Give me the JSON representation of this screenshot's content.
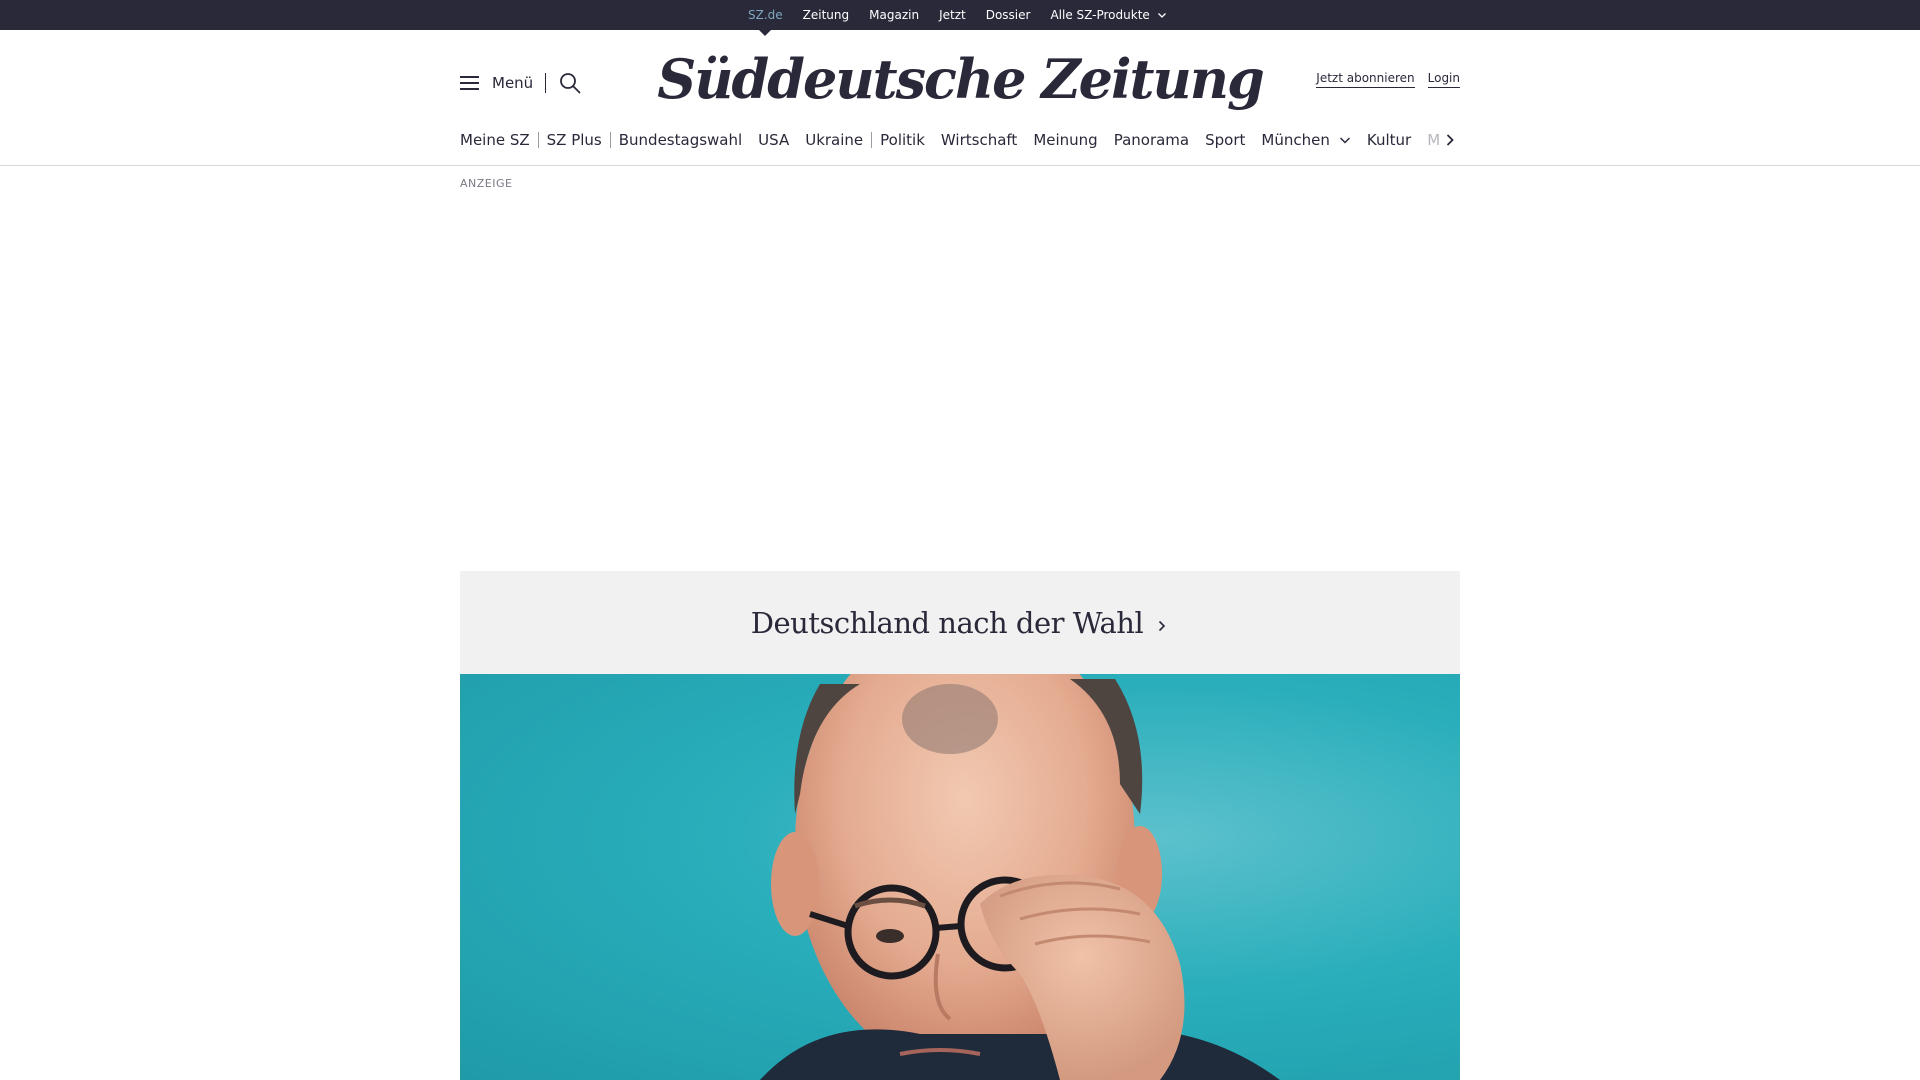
{
  "topbar": {
    "links": [
      {
        "label": "SZ.de",
        "active": true
      },
      {
        "label": "Zeitung"
      },
      {
        "label": "Magazin"
      },
      {
        "label": "Jetzt"
      },
      {
        "label": "Dossier"
      },
      {
        "label": "Alle SZ-Produkte",
        "has_dropdown": true
      }
    ]
  },
  "header": {
    "menu_label": "Menü",
    "logo_text": "Süddeutsche Zeitung",
    "subscribe_label": "Jetzt abonnieren",
    "login_label": "Login"
  },
  "section_nav": {
    "items": [
      {
        "label": "Meine SZ"
      },
      {
        "label": "SZ Plus"
      },
      {
        "label": "Bundestagswahl"
      },
      {
        "label": "USA"
      },
      {
        "label": "Ukraine"
      },
      {
        "label": "Politik"
      },
      {
        "label": "Wirtschaft"
      },
      {
        "label": "Meinung"
      },
      {
        "label": "Panorama"
      },
      {
        "label": "Sport"
      },
      {
        "label": "München",
        "has_dropdown": true
      },
      {
        "label": "Kultur"
      },
      {
        "label": "M"
      }
    ]
  },
  "ad": {
    "label": "ANZEIGE"
  },
  "teaser": {
    "title": "Deutschland nach der Wahl"
  },
  "colors": {
    "brand_dark": "#29293a",
    "active_link": "#7fa8bc",
    "teaser_bg": "#f1f1f1",
    "hero_bg": "#29aebb"
  }
}
